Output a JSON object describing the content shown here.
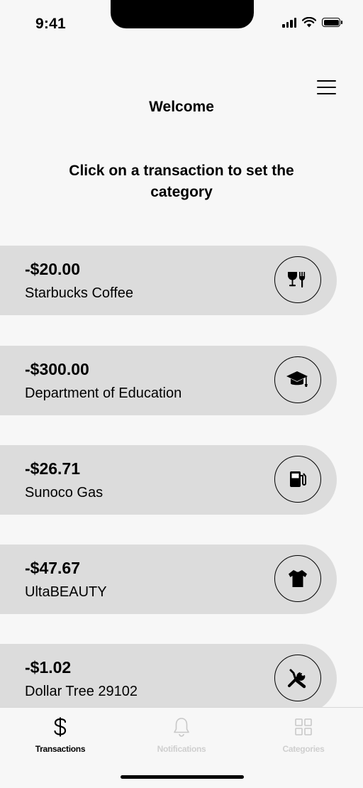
{
  "status_bar": {
    "time": "9:41"
  },
  "header": {
    "title": "Welcome",
    "menu_icon": "hamburger-menu-icon"
  },
  "instructions": "Click on a transaction to set the category",
  "transactions": [
    {
      "amount": "-$20.00",
      "merchant": "Starbucks Coffee",
      "category_icon": "dining-icon"
    },
    {
      "amount": "-$300.00",
      "merchant": "Department of Education",
      "category_icon": "education-icon"
    },
    {
      "amount": "-$26.71",
      "merchant": "Sunoco Gas",
      "category_icon": "gas-icon"
    },
    {
      "amount": "-$47.67",
      "merchant": "UltaBEAUTY",
      "category_icon": "clothing-icon"
    },
    {
      "amount": "-$1.02",
      "merchant": "Dollar Tree 29102",
      "category_icon": "tools-icon"
    }
  ],
  "tab_bar": {
    "tabs": [
      {
        "label": "Transactions",
        "icon": "dollar-icon",
        "active": true
      },
      {
        "label": "Notifications",
        "icon": "bell-icon",
        "active": false
      },
      {
        "label": "Categories",
        "icon": "grid-icon",
        "active": false
      }
    ]
  },
  "colors": {
    "background": "#f7f7f7",
    "card": "#dcdcdc",
    "inactive_tab": "#cfcfcf"
  }
}
